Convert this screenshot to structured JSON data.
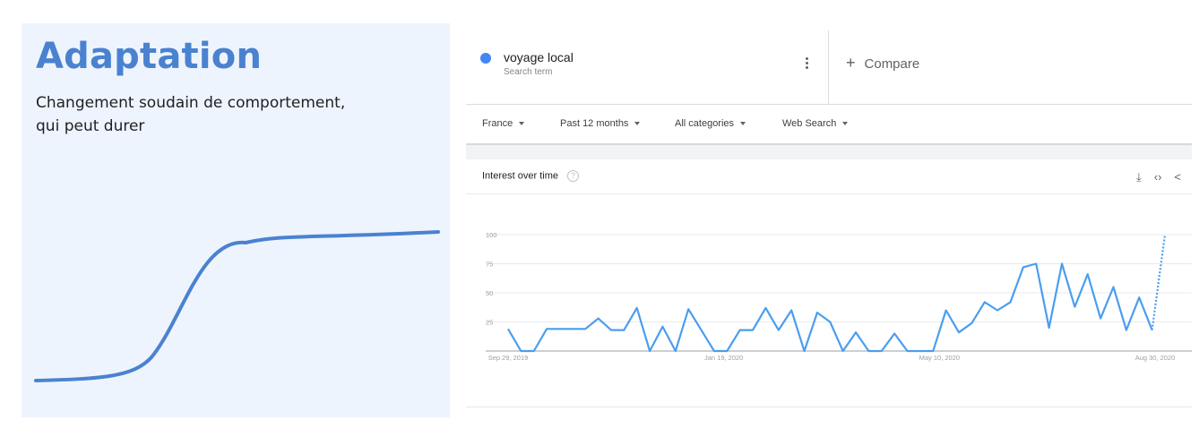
{
  "slide": {
    "title": "Adaptation",
    "subtitle_line1": "Changement soudain de comportement,",
    "subtitle_line2": "qui peut durer",
    "curve_color": "#4a82d0",
    "background": "#eef4fd"
  },
  "term": {
    "name": "voyage local",
    "type": "Search term",
    "dot_color": "#4285f4",
    "more_icon": "vertical-ellipsis-icon"
  },
  "compare": {
    "icon": "plus-icon",
    "label": "Compare"
  },
  "filters": {
    "region": "France",
    "time": "Past 12 months",
    "category": "All categories",
    "property": "Web Search"
  },
  "card": {
    "title": "Interest over time",
    "help_icon": "help-icon",
    "help_glyph": "?",
    "actions": [
      "download-icon",
      "embed-icon",
      "share-icon"
    ]
  },
  "chart_data": {
    "type": "line",
    "y_ticks": [
      100,
      75,
      50,
      25
    ],
    "ylim": [
      0,
      100
    ],
    "x_labels": [
      "Sep 29, 2019",
      "Jan 19, 2020",
      "May 10, 2020",
      "Aug 30, 2020"
    ],
    "grid": true,
    "series": [
      {
        "color": "#4a9eef",
        "values": [
          19,
          0,
          0,
          19,
          19,
          19,
          19,
          28,
          18,
          18,
          37,
          0,
          21,
          0,
          36,
          18,
          0,
          0,
          18,
          18,
          37,
          18,
          35,
          0,
          33,
          25,
          0,
          16,
          0,
          0,
          15,
          0,
          0,
          0,
          35,
          16,
          24,
          42,
          35,
          42,
          72,
          75,
          20,
          75,
          38,
          66,
          28,
          55,
          18,
          46,
          18,
          100
        ],
        "partial_last_point": true
      }
    ]
  }
}
